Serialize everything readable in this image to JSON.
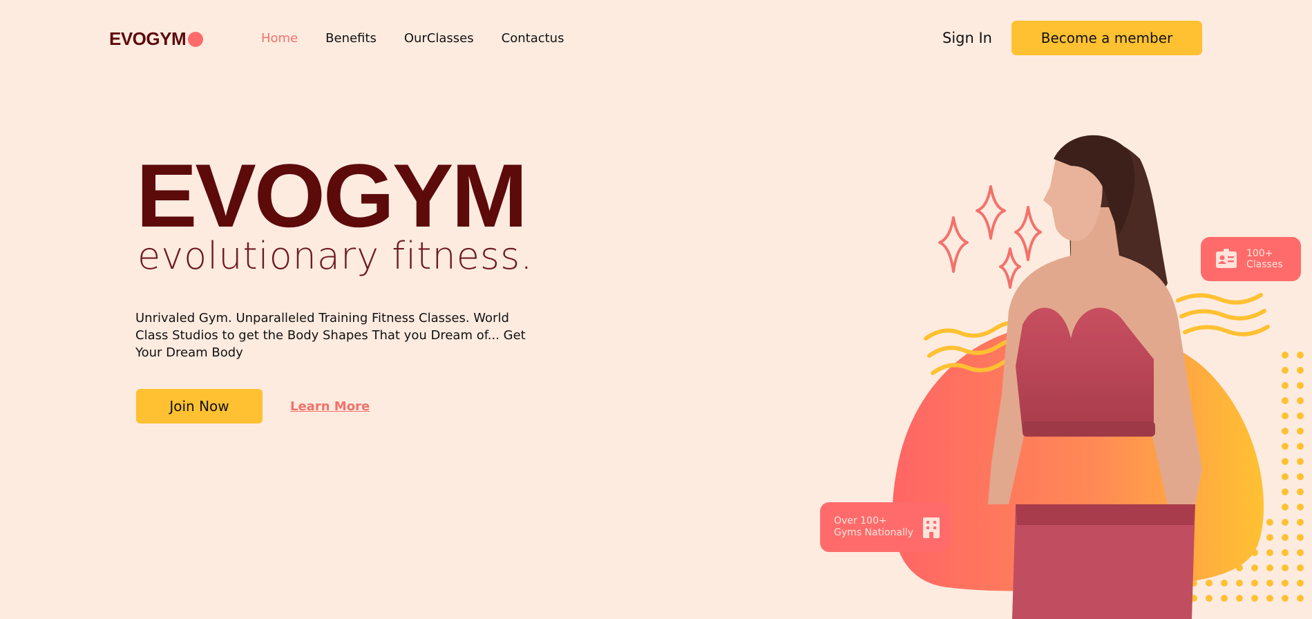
{
  "nav": {
    "logo": "EVOGYM",
    "links": [
      {
        "label": "Home",
        "active": true
      },
      {
        "label": "Benefits",
        "active": false
      },
      {
        "label": "OurClasses",
        "active": false
      },
      {
        "label": "Contactus",
        "active": false
      }
    ],
    "sign_in": "Sign In",
    "cta": "Become a member"
  },
  "hero": {
    "title": "EVOGYM",
    "subtitle": "evolutionary fitness.",
    "description": "Unrivaled Gym. Unparalleled Training Fitness Classes. World Class Studios to get the Body Shapes That you Dream of... Get Your Dream Body",
    "join_button": "Join Now",
    "learn_more": "Learn More"
  },
  "badges": {
    "classes": {
      "line1": "100+",
      "line2": "Classes",
      "icon": "id-card-icon"
    },
    "gyms": {
      "line1": "Over 100+",
      "line2": "Gyms Nationally",
      "icon": "building-icon"
    }
  },
  "colors": {
    "background": "#FEEBE0",
    "brand_dark": "#5C0A0A",
    "accent_coral": "#FF6B6B",
    "accent_yellow": "#FFC132"
  }
}
